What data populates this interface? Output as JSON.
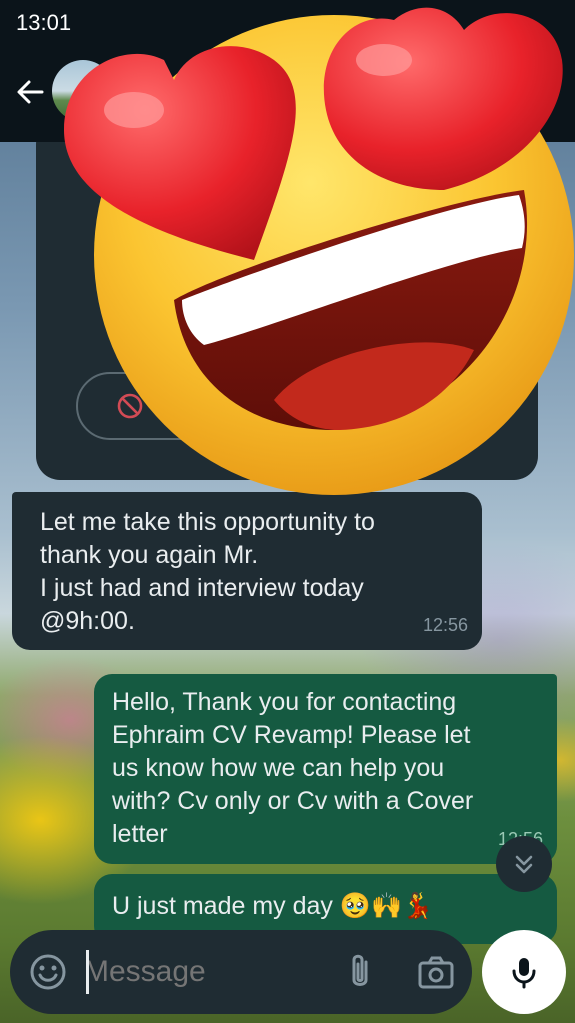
{
  "status_bar": {
    "time": "13:01"
  },
  "header": {
    "back_icon": "arrow-left-icon",
    "avatar": "contact-avatar"
  },
  "previous_card": {
    "icon": "block-icon"
  },
  "messages": [
    {
      "direction": "incoming",
      "text": "Let me take this opportunity to\nthank you again Mr.\nI just had and interview today\n@9h:00.",
      "time": "12:56"
    },
    {
      "direction": "outgoing",
      "text": "Hello, Thank you for contacting\nEphraim CV Revamp! Please let\nus know how we can help you\nwith? Cv only or Cv with a Cover\nletter",
      "time": "12:56"
    },
    {
      "direction": "outgoing",
      "text": "U just made my day 🥹🙌💃",
      "time": ""
    }
  ],
  "overlay": {
    "emoji": "heart-eyes-emoji"
  },
  "input_bar": {
    "placeholder": "Message",
    "icons": [
      "emoji-icon",
      "attach-icon",
      "camera-icon",
      "mic-icon"
    ]
  },
  "colors": {
    "header_bg": "#0b141a",
    "incoming_bubble": "#1f2c33",
    "outgoing_bubble": "#155a41",
    "text": "#e9edef",
    "meta": "#8696a0"
  }
}
